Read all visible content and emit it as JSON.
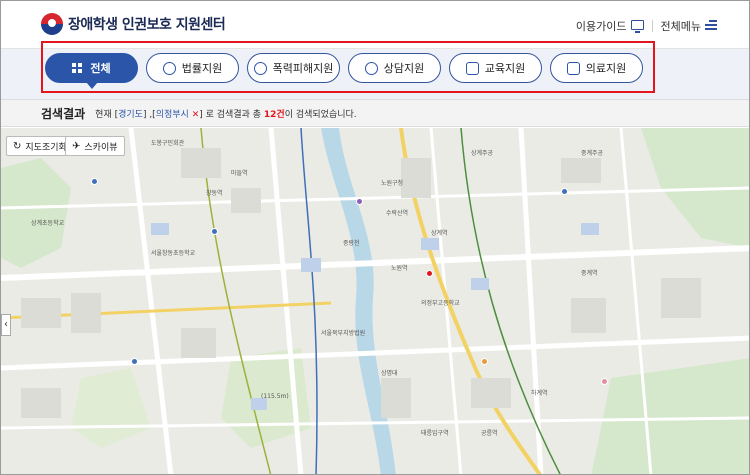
{
  "header": {
    "logo_text": "장애학생 인권보호 지원센터",
    "guide_label": "이용가이드",
    "menu_label": "전체메뉴"
  },
  "nav": {
    "items": [
      {
        "label": "전체",
        "icon": "grid-icon",
        "active": true
      },
      {
        "label": "법률지원",
        "icon": "gavel-icon",
        "active": false
      },
      {
        "label": "폭력피해지원",
        "icon": "face-icon",
        "active": false
      },
      {
        "label": "상담지원",
        "icon": "phone-chat-icon",
        "active": false
      },
      {
        "label": "교육지원",
        "icon": "board-icon",
        "active": false
      },
      {
        "label": "의료지원",
        "icon": "medical-kit-icon",
        "active": false
      }
    ]
  },
  "result": {
    "title": "검색결과",
    "prefix": "현재 [",
    "region1": "경기도",
    "mid": "] ,[",
    "region2": "의정부시",
    "remove": "✕",
    "suffix1": "] 로 검색결과 총 ",
    "count": "12건",
    "suffix2": "이 검색되었습니다."
  },
  "map": {
    "controls": {
      "roadmap_label": "지도조기화",
      "skyview_label": "스카이뷰"
    },
    "labels": [
      {
        "t": "도봉구민회관"
      },
      {
        "t": "상계주공"
      },
      {
        "t": "노원구청"
      },
      {
        "t": "창동역"
      },
      {
        "t": "중계주공"
      },
      {
        "t": "수락산역"
      },
      {
        "t": "서울창동초등학교"
      },
      {
        "t": "상계역"
      },
      {
        "t": "노원역"
      },
      {
        "t": "의정부고등학교"
      },
      {
        "t": "중계역"
      },
      {
        "t": "하계역"
      },
      {
        "t": "서울북부지방법원"
      },
      {
        "t": "상계초등학교"
      },
      {
        "t": "상명대"
      },
      {
        "t": "중랑천"
      },
      {
        "t": "태릉입구역"
      },
      {
        "t": "(115.5m)"
      },
      {
        "t": "공릉역"
      },
      {
        "t": "마들역"
      }
    ]
  },
  "colors": {
    "primary": "#2b55a8",
    "highlight": "#e3161e",
    "result_bg": "#f3f3f3",
    "map_bg": "#ebebe6",
    "river": "#b8d8e8"
  }
}
